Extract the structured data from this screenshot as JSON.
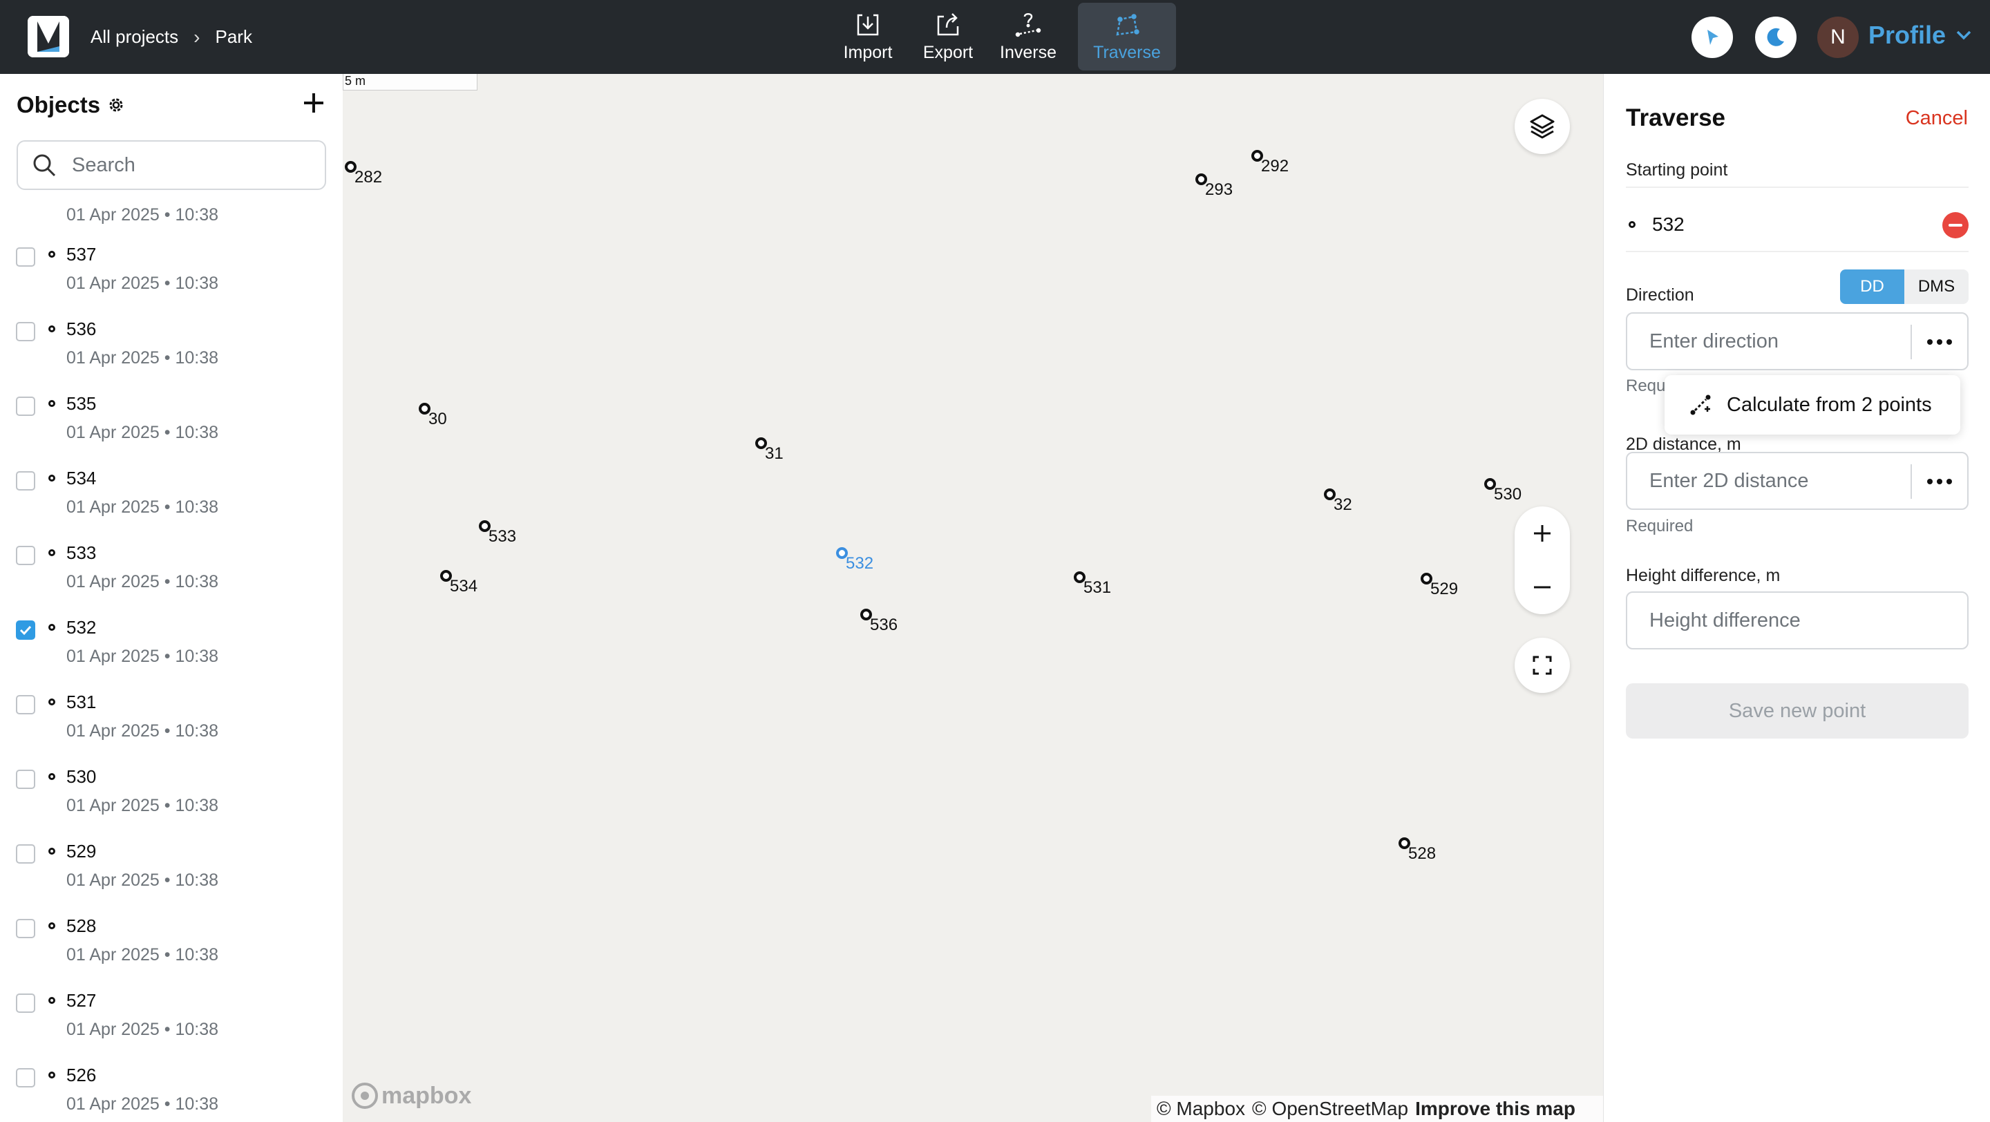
{
  "breadcrumb": {
    "all_projects": "All projects",
    "separator": "›",
    "project": "Park"
  },
  "toolbar": {
    "import": "Import",
    "export": "Export",
    "inverse": "Inverse",
    "traverse": "Traverse",
    "active": "Traverse"
  },
  "user": {
    "initial": "N",
    "profile_label": "Profile",
    "avatar_color": "#5b3a33"
  },
  "colors": {
    "accent": "#4aa3df",
    "danger": "#d9341f",
    "topbar": "#25292d",
    "map_bg": "#f1f0ed"
  },
  "sidebar": {
    "title": "Objects",
    "search_placeholder": "Search",
    "first_row_date": "01 Apr 2025 • 10:38",
    "items": [
      {
        "name": "537",
        "date": "01 Apr 2025 • 10:38",
        "checked": false
      },
      {
        "name": "536",
        "date": "01 Apr 2025 • 10:38",
        "checked": false
      },
      {
        "name": "535",
        "date": "01 Apr 2025 • 10:38",
        "checked": false
      },
      {
        "name": "534",
        "date": "01 Apr 2025 • 10:38",
        "checked": false
      },
      {
        "name": "533",
        "date": "01 Apr 2025 • 10:38",
        "checked": false
      },
      {
        "name": "532",
        "date": "01 Apr 2025 • 10:38",
        "checked": true
      },
      {
        "name": "531",
        "date": "01 Apr 2025 • 10:38",
        "checked": false
      },
      {
        "name": "530",
        "date": "01 Apr 2025 • 10:38",
        "checked": false
      },
      {
        "name": "529",
        "date": "01 Apr 2025 • 10:38",
        "checked": false
      },
      {
        "name": "528",
        "date": "01 Apr 2025 • 10:38",
        "checked": false
      },
      {
        "name": "527",
        "date": "01 Apr 2025 • 10:38",
        "checked": false
      },
      {
        "name": "526",
        "date": "01 Apr 2025 • 10:38",
        "checked": false
      }
    ]
  },
  "map": {
    "scale_label": "5 m",
    "points": [
      "282",
      "292",
      "293",
      "30",
      "31",
      "533",
      "534",
      "532",
      "536",
      "531",
      "32",
      "530",
      "529",
      "528"
    ],
    "selected_point": "532",
    "attribution": {
      "mapbox": "© Mapbox",
      "osm": "© OpenStreetMap",
      "improve": "Improve this map"
    },
    "logo_text": "mapbox",
    "icons": [
      "layers-icon",
      "zoom-in-icon",
      "zoom-out-icon",
      "fullscreen-icon"
    ]
  },
  "panel": {
    "title": "Traverse",
    "cancel": "Cancel",
    "starting_point_label": "Starting point",
    "starting_point_value": "532",
    "direction_label": "Direction",
    "format_dd": "DD",
    "format_dms": "DMS",
    "format_selected": "DD",
    "direction_placeholder": "Enter direction",
    "direction_required": "Requ",
    "popup_item": "Calculate from 2 points",
    "distance_label": "2D distance, m",
    "distance_placeholder": "Enter 2D distance",
    "distance_required": "Required",
    "height_label": "Height difference, m",
    "height_placeholder": "Height difference",
    "save_label": "Save new point"
  }
}
